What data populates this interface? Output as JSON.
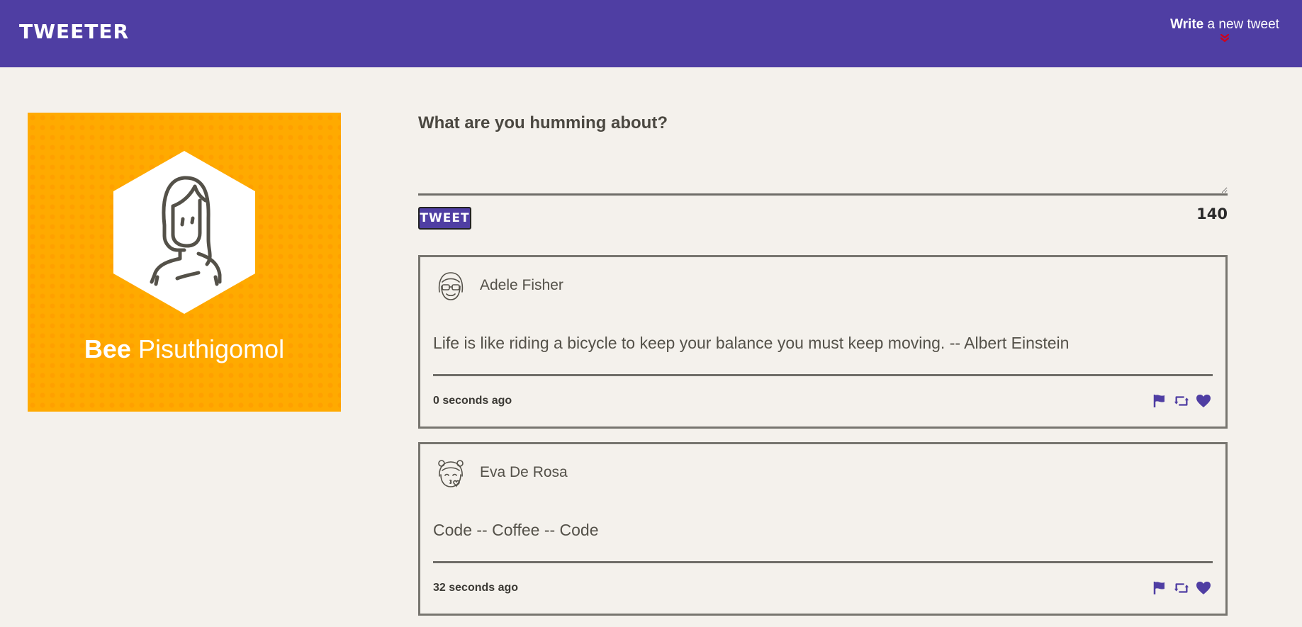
{
  "nav": {
    "brand": "TWEETER",
    "compose_bold": "Write",
    "compose_rest": " a new tweet",
    "compose_icon": "double-chevron-down-icon"
  },
  "profile": {
    "first_name": "Bee",
    "last_name": "Pisuthigomol",
    "avatar_icon": "woman-avatar-icon"
  },
  "composer": {
    "prompt": "What are you humming about?",
    "text_value": "",
    "button_label": "TWEET",
    "char_count": "140"
  },
  "tweets": [
    {
      "author": "Adele Fisher",
      "text": "Life is like riding a bicycle to keep your balance you must keep moving. -- Albert Einstein",
      "timestamp": "0 seconds ago",
      "avatar_icon": "woman-sunglasses-avatar-icon"
    },
    {
      "author": "Eva De Rosa",
      "text": "Code -- Coffee -- Code",
      "timestamp": "32 seconds ago",
      "avatar_icon": "woman-kiss-avatar-icon"
    }
  ],
  "actions": [
    "flag-icon",
    "retweet-icon",
    "heart-icon"
  ],
  "colors": {
    "nav": "#4f3ea3",
    "accent": "#4f3ea3",
    "profile_bg": "#ffaa00",
    "chevron": "#d0021b",
    "background": "#f4f1ec"
  }
}
